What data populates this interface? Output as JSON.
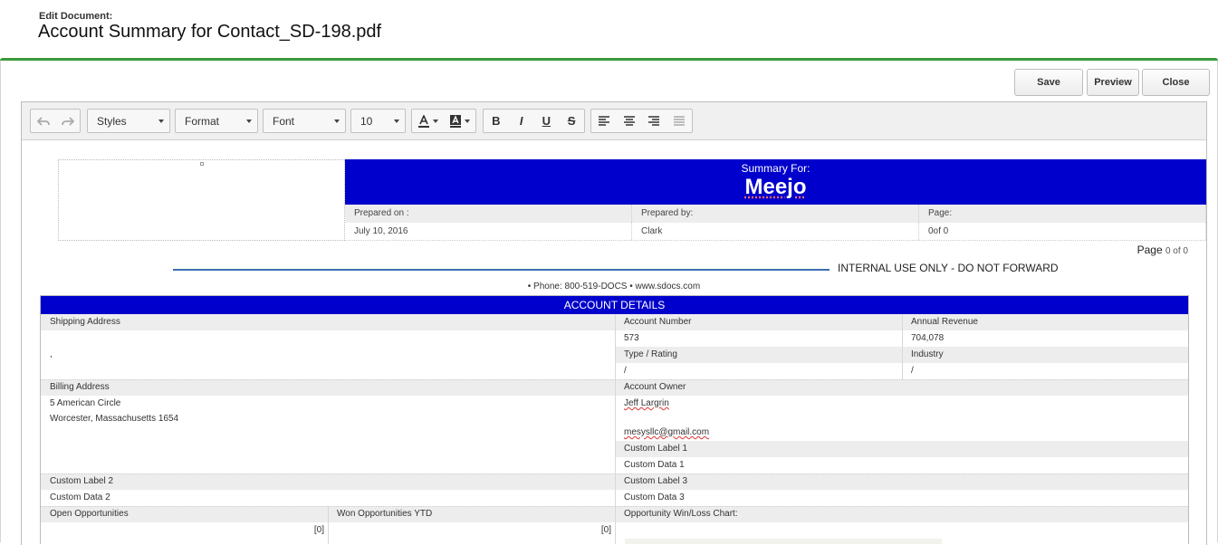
{
  "header": {
    "subtitle": "Edit Document:",
    "title": "Account Summary for Contact_SD-198.pdf"
  },
  "actions": {
    "save": "Save",
    "preview": "Preview",
    "close": "Close"
  },
  "toolbar": {
    "styles": "Styles",
    "format": "Format",
    "font": "Font",
    "size": "10",
    "bold": "B",
    "italic": "I",
    "underline": "U",
    "strike": "S"
  },
  "doc_header": {
    "summary_for_label": "Summary For:",
    "summary_for_name": "Meejo",
    "prepared_on_label": "Prepared on :",
    "prepared_by_label": "Prepared by:",
    "page_label": "Page:",
    "prepared_on_value": "July 10, 2016",
    "prepared_by_value": "Clark",
    "page_value": "0of 0"
  },
  "page_count": {
    "label": "Page",
    "value": "0 of 0"
  },
  "internal_notice": "INTERNAL USE ONLY - DO NOT FORWARD",
  "phone_line": "• Phone: 800-519-DOCS • www.sdocs.com",
  "account_details": {
    "title": "ACCOUNT DETAILS",
    "shipping_address_label": "Shipping Address",
    "shipping_address_value": ",",
    "account_number_label": "Account Number",
    "account_number_value": "573",
    "annual_revenue_label": "Annual Revenue",
    "annual_revenue_value": "704,078",
    "type_rating_label": "Type / Rating",
    "type_rating_value": "/",
    "industry_label": "Industry",
    "industry_value": "/",
    "billing_address_label": "Billing Address",
    "billing_line1": "5 American Circle",
    "billing_line2": "Worcester, Massachusetts 1654",
    "account_owner_label": "Account Owner",
    "account_owner_name": "Jeff Largrin",
    "account_owner_email": "mesysllc@gmail.com",
    "custom_label_1": "Custom Label 1",
    "custom_data_1": "Custom Data 1",
    "custom_label_2": "Custom Label 2",
    "custom_data_2": "Custom Data 2",
    "custom_label_3": "Custom Label 3",
    "custom_data_3": "Custom Data 3",
    "open_opps_label": "Open Opportunities",
    "open_opps_value": "[0]",
    "won_opps_label": "Won Opportunities YTD",
    "won_opps_value": "[0]",
    "chart_label": "Opportunity Win/Loss Chart:"
  }
}
